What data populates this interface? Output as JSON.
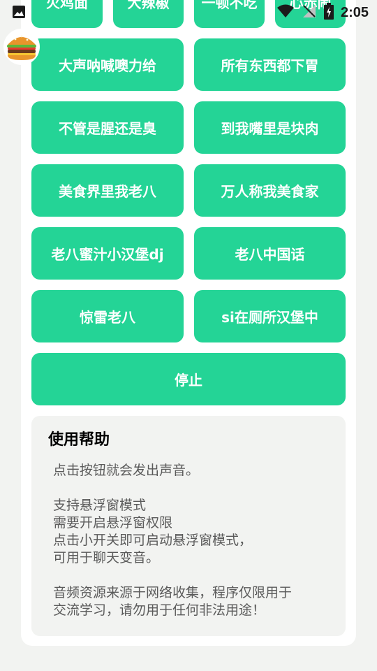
{
  "status_bar": {
    "time": "2:05",
    "icons": [
      "image-icon",
      "wifi-icon",
      "signal-icon",
      "battery-icon"
    ]
  },
  "top_partial_buttons": [
    "火鸡面",
    "大辣椒",
    "一顿不吃",
    "心赤闹"
  ],
  "buttons": [
    "大声呐喊噢力给",
    "所有东西都下胃",
    "不管是腥还是臭",
    "到我嘴里是块肉",
    "美食界里我老八",
    "万人称我美食家",
    "老八蜜汁小汉堡dj",
    "老八中国话",
    "惊雷老八",
    "si在厕所汉堡中"
  ],
  "stop_label": "停止",
  "help": {
    "title": "使用帮助",
    "text": "点击按钮就会发出声音。\n\n支持悬浮窗模式\n需要开启悬浮窗权限\n点击小开关即可启动悬浮窗模式，\n可用于聊天变音。\n\n音频资源来源于网络收集，程序仅限用于\n交流学习，请勿用于任何非法用途！"
  },
  "colors": {
    "accent": "#24d496",
    "background": "#f2f3f1",
    "card": "#ffffff"
  }
}
